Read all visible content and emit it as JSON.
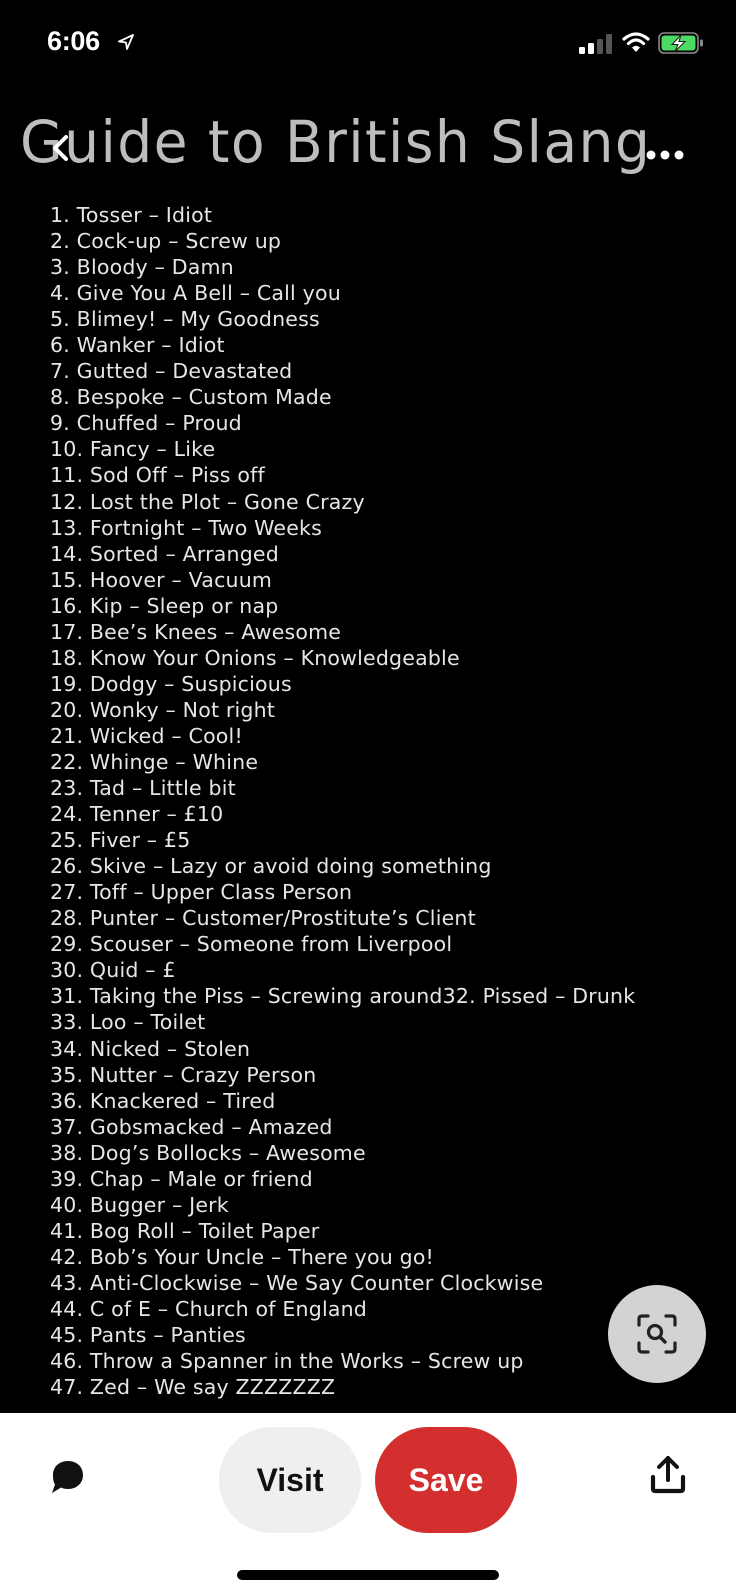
{
  "status_bar": {
    "time": "6:06",
    "location_icon": "location-arrow-icon",
    "signal_bars_active": 2,
    "signal_bars_total": 4,
    "wifi_icon": "wifi-icon",
    "battery_state": "charging",
    "battery_color": "#4cd964"
  },
  "header": {
    "back_icon": "chevron-left-icon",
    "more_icon": "ellipsis-icon"
  },
  "pin": {
    "title": "Guide to British Slang",
    "items": [
      "1. Tosser – Idiot",
      "2. Cock-up – Screw up",
      "3. Bloody – Damn",
      "4. Give You A Bell – Call you",
      "5. Blimey! – My Goodness",
      "6. Wanker – Idiot",
      "7. Gutted – Devastated",
      "8. Bespoke – Custom Made",
      "9. Chuffed – Proud",
      "10. Fancy – Like",
      "11. Sod Off – Piss off",
      "12. Lost the Plot – Gone Crazy",
      "13. Fortnight – Two Weeks",
      "14. Sorted – Arranged",
      "15. Hoover – Vacuum",
      "16. Kip – Sleep or nap",
      "17. Bee’s Knees – Awesome",
      "18. Know Your Onions – Knowledgeable",
      "19. Dodgy – Suspicious",
      "20. Wonky – Not right",
      "21. Wicked – Cool!",
      "22. Whinge – Whine",
      "23. Tad – Little bit",
      "24. Tenner – £10",
      "25. Fiver – £5",
      "26. Skive – Lazy or avoid doing something",
      "27. Toff – Upper Class Person",
      "28. Punter – Customer/Prostitute’s Client",
      "29. Scouser – Someone from Liverpool",
      "30. Quid – £",
      "31. Taking the Piss – Screwing around32. Pissed – Drunk",
      "33. Loo – Toilet",
      "34. Nicked – Stolen",
      "35. Nutter – Crazy Person",
      "36. Knackered – Tired",
      "37. Gobsmacked – Amazed",
      "38. Dog’s Bollocks – Awesome",
      "39. Chap – Male or friend",
      "40. Bugger – Jerk",
      "41. Bog Roll – Toilet Paper",
      "42. Bob’s Your Uncle – There you go!",
      "43. Anti-Clockwise – We Say Counter Clockwise",
      "44. C of E – Church of England",
      "45. Pants – Panties",
      "46. Throw a Spanner in the Works – Screw up",
      "47. Zed – We say ZZZZZZZ"
    ]
  },
  "visual_search": {
    "icon": "visual-search-lens-icon"
  },
  "action_bar": {
    "comment_icon": "comment-bubble-icon",
    "visit_label": "Visit",
    "save_label": "Save",
    "share_icon": "share-upload-icon",
    "save_color": "#d32f2f",
    "visit_color": "#efefef"
  }
}
